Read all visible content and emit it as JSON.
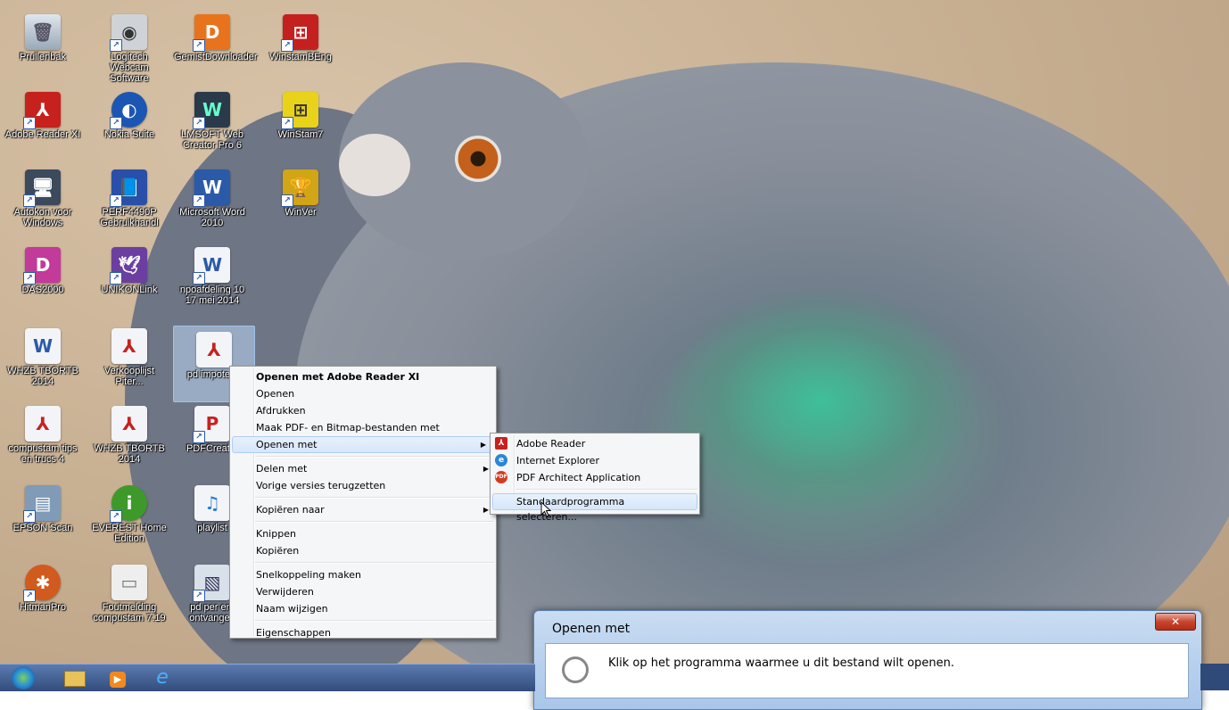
{
  "desktop_icons": [
    {
      "label": "Prullenbak"
    },
    {
      "label": "Logitech Webcam Software"
    },
    {
      "label": "GemistDownloader"
    },
    {
      "label": "WinstamBEng"
    },
    {
      "label": "Adobe Reader XI"
    },
    {
      "label": "Nokia Suite"
    },
    {
      "label": "LMSOFT Web Creator Pro 6"
    },
    {
      "label": "WinStam7"
    },
    {
      "label": "Autokon voor Windows"
    },
    {
      "label": "PERF4490P Gebruikhandl"
    },
    {
      "label": "Microsoft Word 2010"
    },
    {
      "label": "WinVer"
    },
    {
      "label": "DAS2000"
    },
    {
      "label": "UNIKONLink"
    },
    {
      "label": "npoafdeling 10 17 mei 2014"
    },
    {
      "label": "WHZB TBORTB 2014"
    },
    {
      "label": "Verkooplijst Piter..."
    },
    {
      "label": "pd impoter..."
    },
    {
      "label": "compustam tips en trucs 4"
    },
    {
      "label": "WHZB TBORTB 2014"
    },
    {
      "label": "PDFCreat..."
    },
    {
      "label": "EPSON Scan"
    },
    {
      "label": "EVEREST Home Edition"
    },
    {
      "label": "playlist"
    },
    {
      "label": "HitmanPro"
    },
    {
      "label": "Foutmelding compustam 7.19"
    },
    {
      "label": "pd per em ontvangen"
    }
  ],
  "context_menu": {
    "items": [
      {
        "label": "Openen met Adobe Reader XI"
      },
      {
        "label": "Openen"
      },
      {
        "label": "Afdrukken"
      },
      {
        "label": "Maak PDF- en Bitmap-bestanden met PDFCreator"
      },
      {
        "label": "Openen met"
      },
      {
        "label": "Delen met"
      },
      {
        "label": "Vorige versies terugzetten"
      },
      {
        "label": "Kopiëren naar"
      },
      {
        "label": "Knippen"
      },
      {
        "label": "Kopiëren"
      },
      {
        "label": "Snelkoppeling maken"
      },
      {
        "label": "Verwijderen"
      },
      {
        "label": "Naam wijzigen"
      },
      {
        "label": "Eigenschappen"
      }
    ]
  },
  "submenu": {
    "items": [
      {
        "label": "Adobe Reader",
        "icon": "adobe-reader-icon"
      },
      {
        "label": "Internet Explorer",
        "icon": "internet-explorer-icon"
      },
      {
        "label": "PDF Architect Application",
        "icon": "pdf-architect-icon"
      },
      {
        "label": "Standaardprogramma selecteren..."
      }
    ]
  },
  "dialog": {
    "title": "Openen met",
    "instruction": "Klik op het programma waarmee u dit bestand wilt openen."
  },
  "taskbar": {
    "items": [
      "start-orb",
      "explorer",
      "media-player",
      "internet-explorer"
    ]
  },
  "colors": {
    "menu_bg": "#f5f6f7",
    "highlight": "#d6e6fa",
    "taskbar": "#324c7c",
    "dialog_frame": "#a9c6ea",
    "close_button": "#c7452e"
  }
}
